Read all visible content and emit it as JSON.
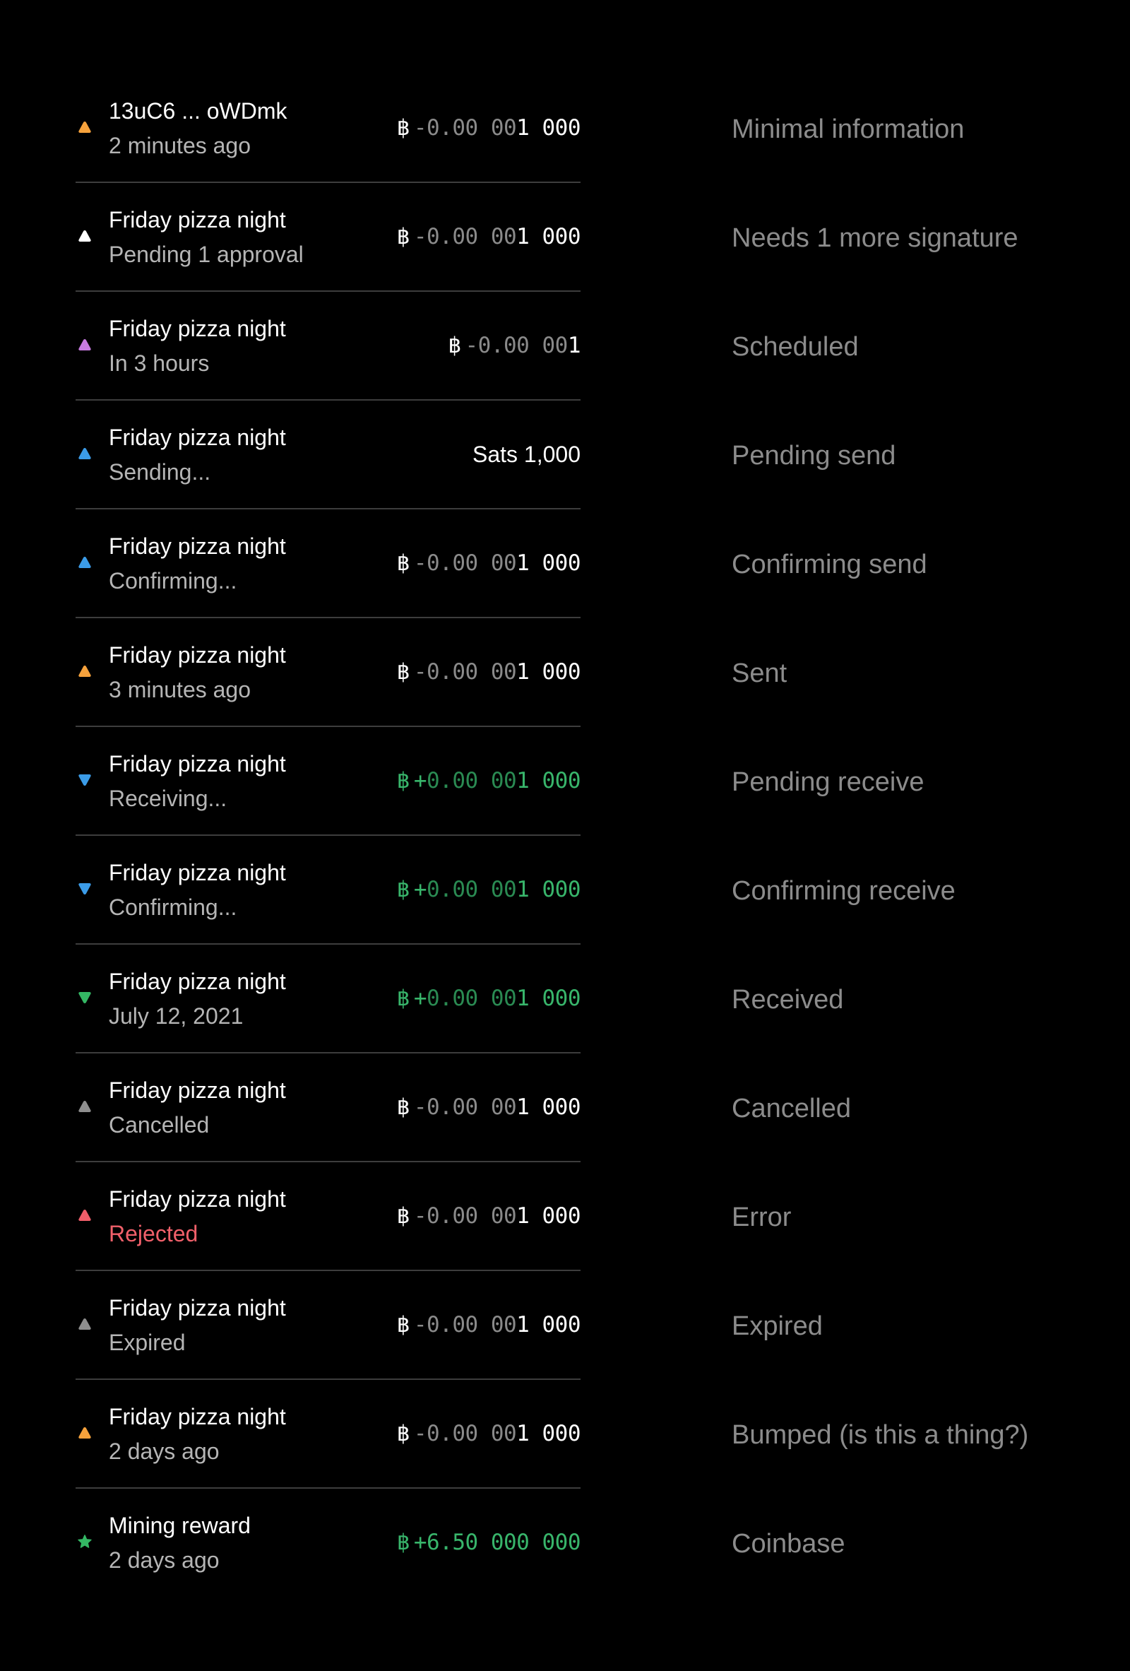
{
  "colors": {
    "orange": "#f6a23c",
    "white": "#ffffff",
    "purple": "#c77be0",
    "blue": "#3b9ce8",
    "green": "#34b764",
    "gray": "#8e8e8e",
    "red": "#ef5d69"
  },
  "transactions": [
    {
      "title": "13uC6 ... oWDmk",
      "subtitle": "2 minutes ago",
      "icon": "send-arrow-icon",
      "amount": {
        "sym": "฿",
        "sign": "-",
        "dim": "0.00 00",
        "main": "1 000"
      },
      "state": "Minimal information"
    },
    {
      "title": "Friday pizza night",
      "subtitle": "Pending 1 approval",
      "icon": "send-arrow-icon",
      "amount": {
        "sym": "฿",
        "sign": "-",
        "dim": "0.00 00",
        "main": "1 000"
      },
      "state": "Needs 1 more signature"
    },
    {
      "title": "Friday pizza night",
      "subtitle": "In 3 hours",
      "icon": "send-arrow-icon",
      "amount": {
        "sym": "฿",
        "sign": "-",
        "dim": "0.00 00",
        "main": "1"
      },
      "state": "Scheduled"
    },
    {
      "title": "Friday pizza night",
      "subtitle": "Sending...",
      "icon": "send-arrow-icon",
      "amount": {
        "text": "Sats 1,000"
      },
      "state": "Pending send"
    },
    {
      "title": "Friday pizza night",
      "subtitle": "Confirming...",
      "icon": "send-arrow-icon",
      "amount": {
        "sym": "฿",
        "sign": "-",
        "dim": "0.00 00",
        "main": "1 000"
      },
      "state": "Confirming send"
    },
    {
      "title": "Friday pizza night",
      "subtitle": "3 minutes ago",
      "icon": "send-arrow-icon",
      "amount": {
        "sym": "฿",
        "sign": "-",
        "dim": "0.00 00",
        "main": "1 000"
      },
      "state": "Sent"
    },
    {
      "title": "Friday pizza night",
      "subtitle": "Receiving...",
      "icon": "receive-arrow-icon",
      "amount": {
        "sym": "฿",
        "sign": "+",
        "dim": "0.00 00",
        "main": "1 000"
      },
      "state": "Pending receive"
    },
    {
      "title": "Friday pizza night",
      "subtitle": "Confirming...",
      "icon": "receive-arrow-icon",
      "amount": {
        "sym": "฿",
        "sign": "+",
        "dim": "0.00 00",
        "main": "1 000"
      },
      "state": "Confirming receive"
    },
    {
      "title": "Friday pizza night",
      "subtitle": "July 12, 2021",
      "icon": "receive-arrow-icon",
      "amount": {
        "sym": "฿",
        "sign": "+",
        "dim": "0.00 00",
        "main": "1 000"
      },
      "state": "Received"
    },
    {
      "title": "Friday pizza night",
      "subtitle": "Cancelled",
      "icon": "send-arrow-icon",
      "amount": {
        "sym": "฿",
        "sign": "-",
        "dim": "0.00 00",
        "main": "1 000"
      },
      "state": "Cancelled"
    },
    {
      "title": "Friday pizza night",
      "subtitle": "Rejected",
      "icon": "send-arrow-icon",
      "amount": {
        "sym": "฿",
        "sign": "-",
        "dim": "0.00 00",
        "main": "1 000"
      },
      "state": "Error"
    },
    {
      "title": "Friday pizza night",
      "subtitle": "Expired",
      "icon": "send-arrow-icon",
      "amount": {
        "sym": "฿",
        "sign": "-",
        "dim": "0.00 00",
        "main": "1 000"
      },
      "state": "Expired"
    },
    {
      "title": "Friday pizza night",
      "subtitle": "2 days ago",
      "icon": "send-arrow-icon",
      "amount": {
        "sym": "฿",
        "sign": "-",
        "dim": "0.00 00",
        "main": "1 000"
      },
      "state": "Bumped (is this a thing?)"
    },
    {
      "title": "Mining reward",
      "subtitle": "2 days ago",
      "icon": "star-icon",
      "amount": {
        "sym": "฿",
        "sign": "+",
        "dim": "",
        "main": "6.50 000 000"
      },
      "state": "Coinbase"
    }
  ]
}
